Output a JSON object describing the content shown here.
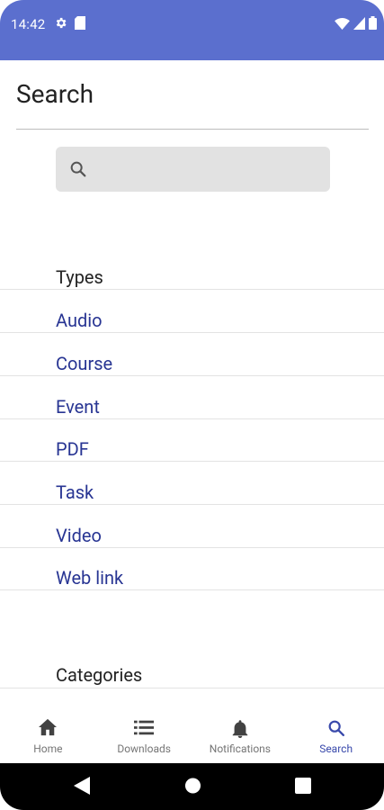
{
  "status_bar": {
    "time": "14:42",
    "icons_left": [
      "settings-gear-icon",
      "sim-card-icon"
    ],
    "icons_right": [
      "wifi-icon",
      "signal-icon",
      "battery-icon"
    ],
    "color": "#5b6fce"
  },
  "page": {
    "title": "Search"
  },
  "search": {
    "placeholder": "",
    "value": ""
  },
  "types": {
    "header": "Types",
    "items": [
      "Audio",
      "Course",
      "Event",
      "PDF",
      "Task",
      "Video",
      "Web link"
    ]
  },
  "categories": {
    "header": "Categories"
  },
  "bottom_nav": {
    "items": [
      {
        "label": "Home",
        "icon": "home-icon"
      },
      {
        "label": "Downloads",
        "icon": "list-icon"
      },
      {
        "label": "Notifications",
        "icon": "bell-icon"
      },
      {
        "label": "Search",
        "icon": "search-icon",
        "active": true
      }
    ],
    "active_color": "#3949ab"
  },
  "system_nav": {
    "buttons": [
      "back-icon",
      "home-circle-icon",
      "recents-square-icon"
    ]
  }
}
